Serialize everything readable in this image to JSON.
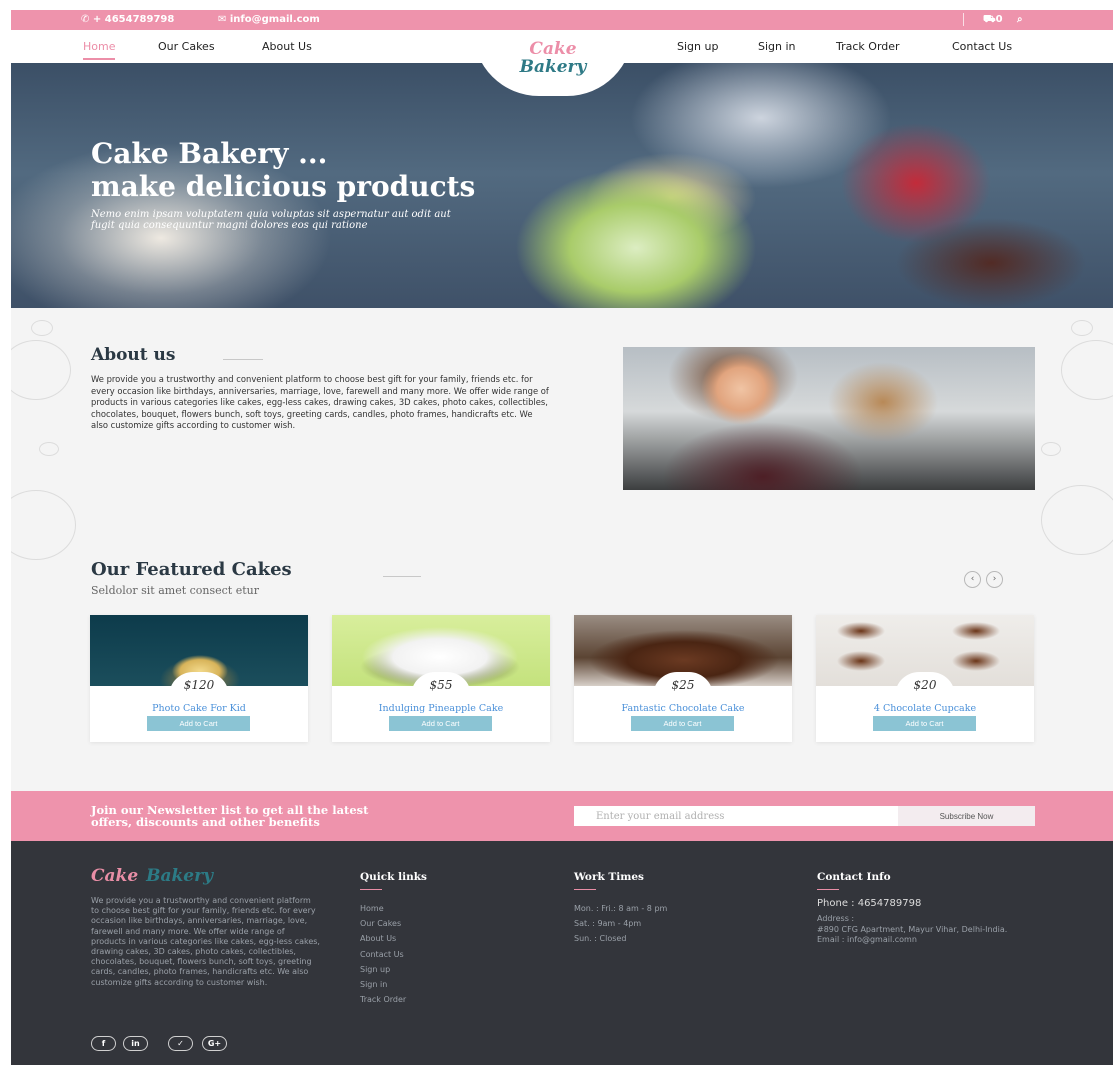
{
  "topbar": {
    "phone": "+ 4654789798",
    "email": "info@gmail.com",
    "cart_count": "0"
  },
  "nav": {
    "left": [
      "Home",
      "Our Cakes",
      "About Us"
    ],
    "right": [
      "Sign up",
      "Sign in",
      "Track Order",
      "Contact Us"
    ],
    "active": "Home"
  },
  "logo": {
    "line1": "Cake",
    "line2": "Bakery"
  },
  "hero": {
    "title_line1": "Cake Bakery ...",
    "title_line2": "make delicious products",
    "subtitle_line1": "Nemo enim ipsam voluptatem quia voluptas sit aspernatur aut odit aut",
    "subtitle_line2": "fugit quia consequuntur magni dolores eos qui ratione"
  },
  "about": {
    "title": "About us",
    "text": "We provide you a trustworthy and convenient platform to choose best gift for your family, friends etc. for every occasion like birthdays, anniversaries, marriage, love, farewell and many more. We offer wide range of products in various categories like cakes, egg-less cakes, drawing cakes, 3D cakes, photo cakes, collectibles, chocolates, bouquet, flowers bunch, soft toys, greeting cards, candles, photo frames, handicrafts etc. We also customize gifts according to customer wish."
  },
  "featured": {
    "title": "Our Featured Cakes",
    "subtitle": "Seldolor sit amet consect etur",
    "prev": "‹",
    "next": "›",
    "cards": [
      {
        "price": "$120",
        "name": "Photo Cake For Kid",
        "button": "Add to Cart"
      },
      {
        "price": "$55",
        "name": "Indulging Pineapple Cake",
        "button": "Add to Cart"
      },
      {
        "price": "$25",
        "name": "Fantastic Chocolate Cake",
        "button": "Add to Cart"
      },
      {
        "price": "$20",
        "name": "4 Chocolate Cupcake",
        "button": "Add to Cart"
      }
    ]
  },
  "newsletter": {
    "text_line1": "Join our Newsletter list to get all the latest",
    "text_line2": "offers, discounts and other benefits",
    "placeholder": "Enter your email address",
    "button": "Subscribe Now"
  },
  "footer": {
    "logo_a": "Cake",
    "logo_b": "Bakery",
    "about": "We provide you a trustworthy and convenient platform to choose best gift for your family, friends etc. for every occasion like birthdays, anniversaries, marriage, love, farewell and many more. We offer wide range of products in various categories like cakes, egg-less cakes, drawing cakes, 3D cakes, photo cakes, collectibles, chocolates, bouquet, flowers bunch, soft toys, greeting cards, candles, photo frames, handicrafts etc. We also customize gifts according to customer wish.",
    "quick_links_title": "Quick links",
    "quick_links": [
      "Home",
      "Our Cakes",
      "About Us",
      "Contact Us",
      "Sign up",
      "Sign in",
      "Track Order"
    ],
    "work_times_title": "Work Times",
    "work_times": [
      "Mon. : Fri.: 8 am - 8 pm",
      "Sat. : 9am - 4pm",
      "Sun. : Closed"
    ],
    "contact_title": "Contact Info",
    "phone": "Phone : 4654789798",
    "address_label": "Address :",
    "address": "#890 CFG Apartment, Mayur Vihar, Delhi-India.",
    "email": "Email : info@gmail.comn",
    "social": [
      "f",
      "in",
      "✓",
      "G+"
    ]
  },
  "colors": {
    "accent_pink": "#ee93ac",
    "teal": "#2f7a86",
    "footer_bg": "#33353b",
    "button_blue": "#8bc4d4"
  }
}
